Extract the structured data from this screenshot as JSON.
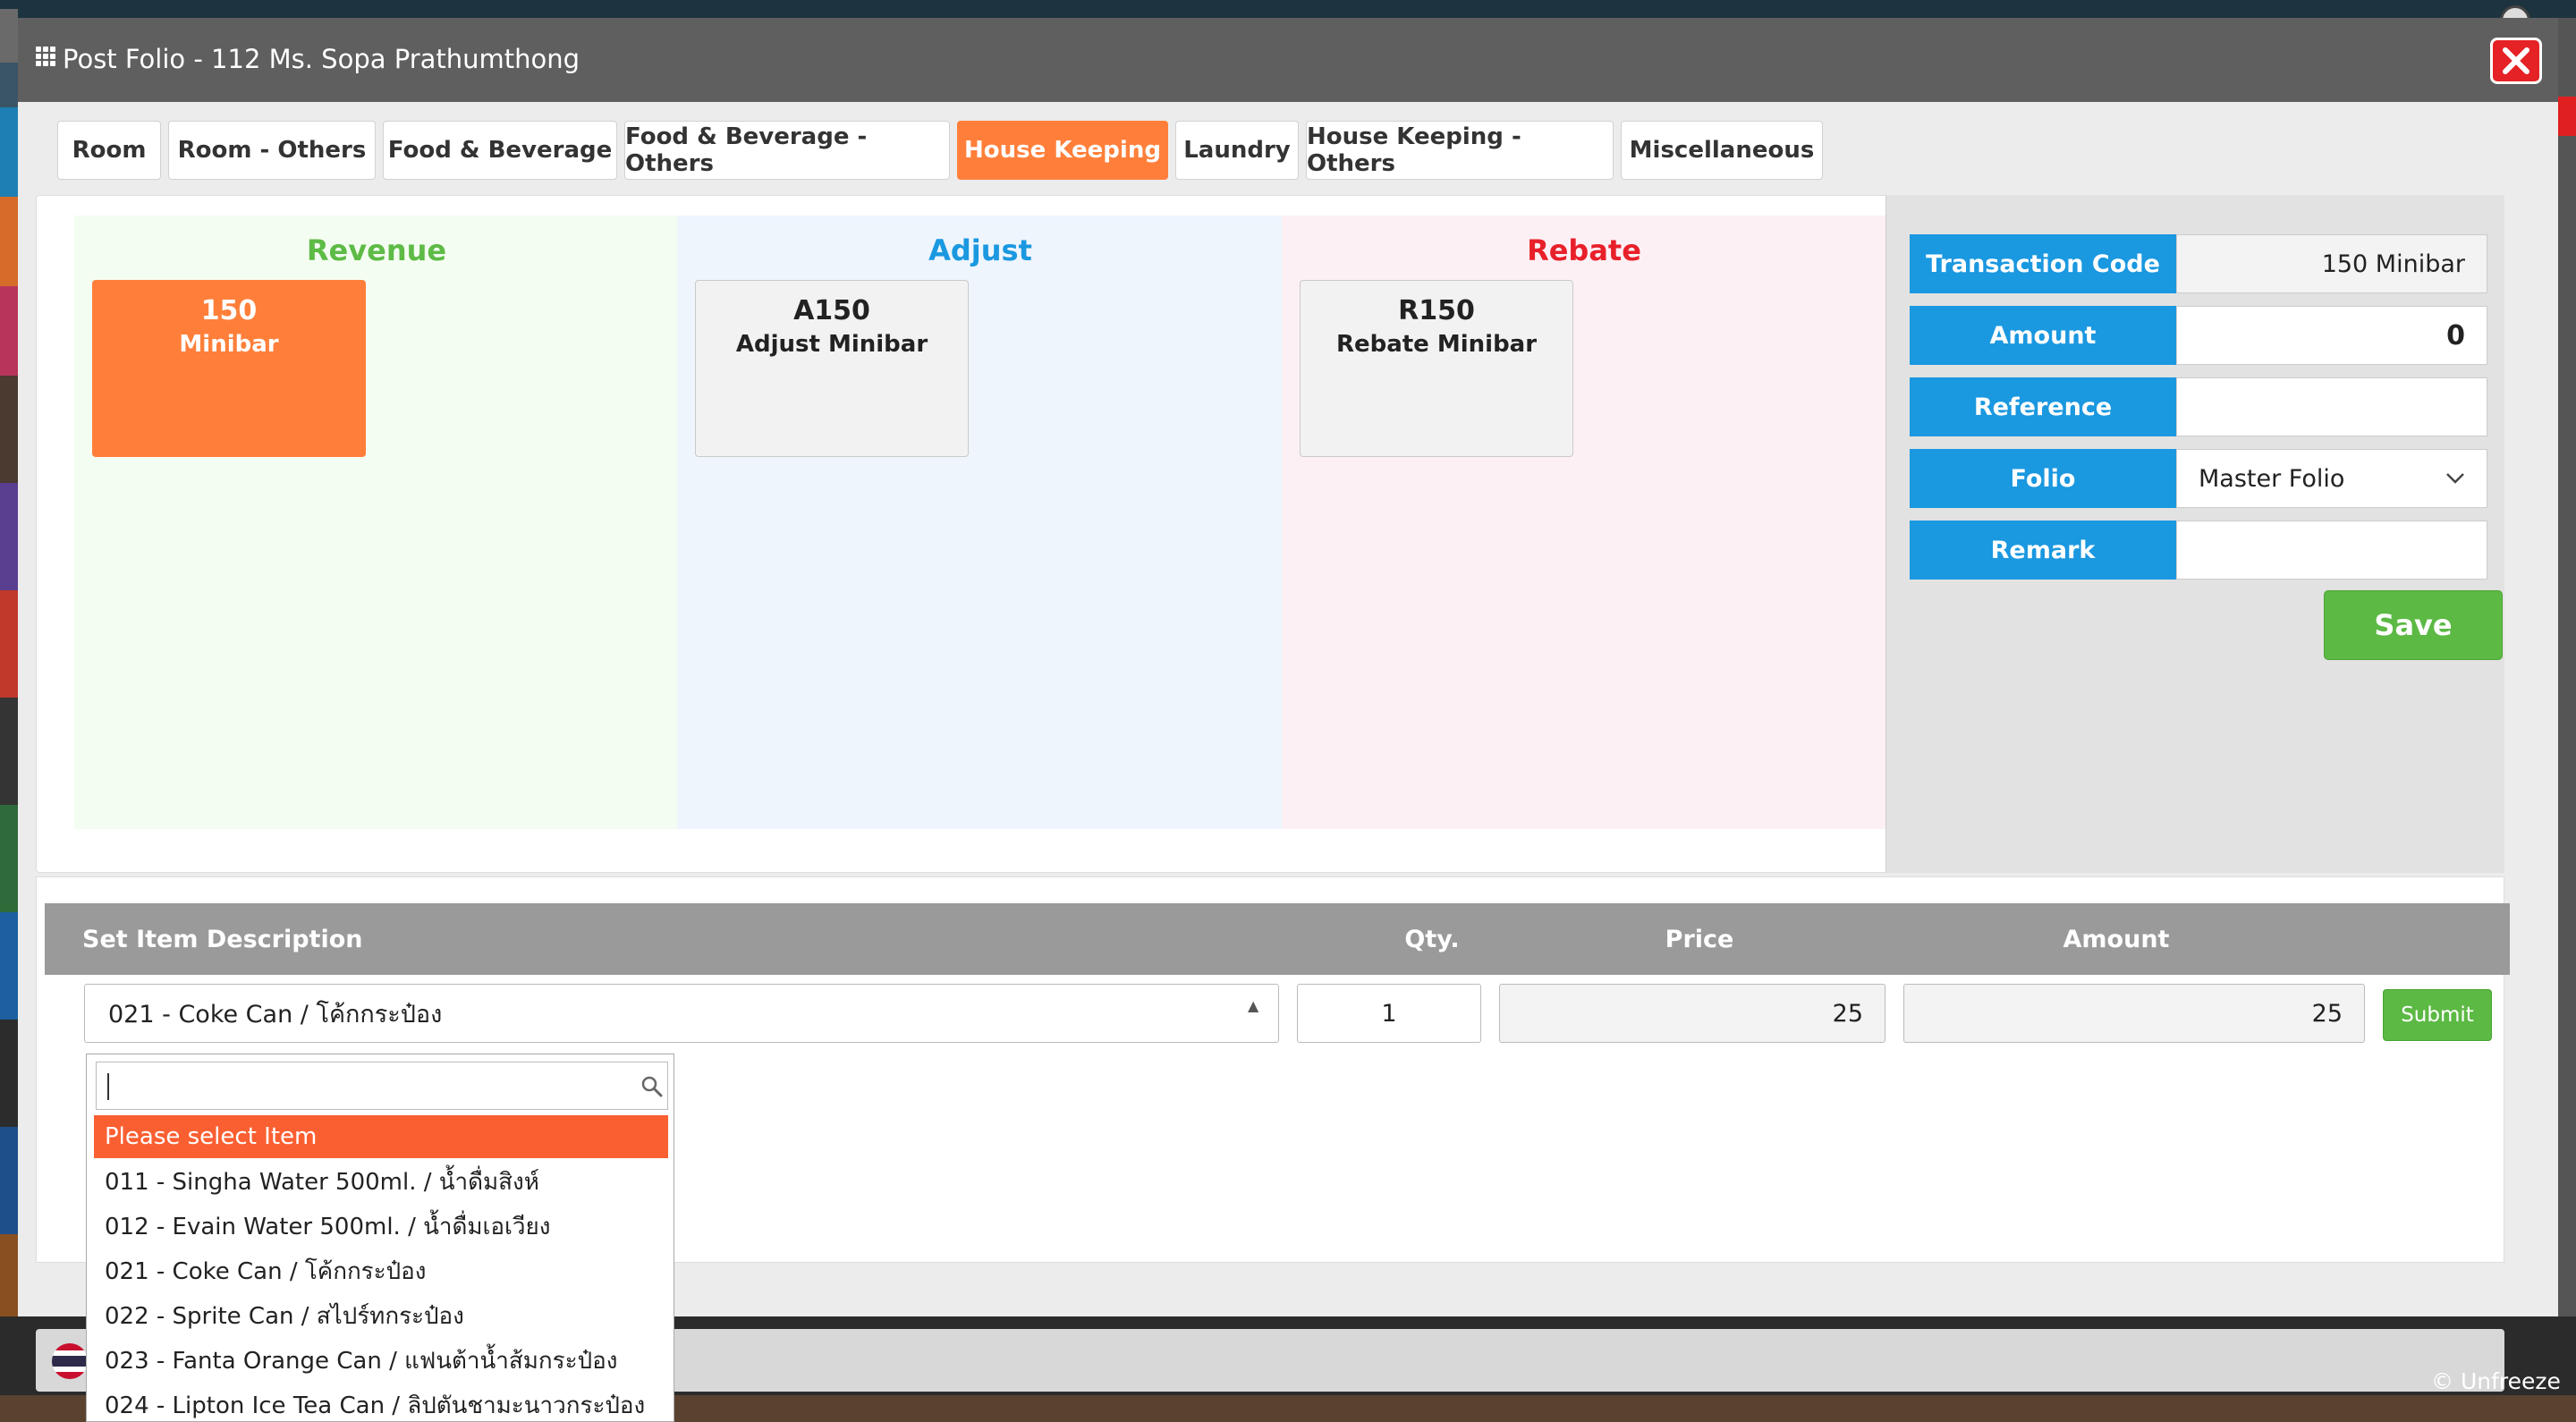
{
  "window": {
    "title": "Post Folio - 112 Ms. Sopa Prathumthong"
  },
  "tabs": [
    {
      "label": "Room"
    },
    {
      "label": "Room - Others"
    },
    {
      "label": "Food & Beverage"
    },
    {
      "label": "Food & Beverage - Others"
    },
    {
      "label": "House Keeping",
      "active": true
    },
    {
      "label": "Laundry"
    },
    {
      "label": "House Keeping - Others"
    },
    {
      "label": "Miscellaneous"
    }
  ],
  "columns": {
    "revenue": {
      "title": "Revenue",
      "color": "#5dbb46",
      "card": {
        "code": "150",
        "name": "Minibar"
      }
    },
    "adjust": {
      "title": "Adjust",
      "color": "#1a98e0",
      "card": {
        "code": "A150",
        "name": "Adjust Minibar"
      }
    },
    "rebate": {
      "title": "Rebate",
      "color": "#e8202a",
      "card": {
        "code": "R150",
        "name": "Rebate Minibar"
      }
    }
  },
  "form": {
    "transaction_code": {
      "label": "Transaction Code",
      "value": "150 Minibar"
    },
    "amount": {
      "label": "Amount",
      "value": "0"
    },
    "reference": {
      "label": "Reference",
      "value": ""
    },
    "folio": {
      "label": "Folio",
      "value": "Master Folio"
    },
    "remark": {
      "label": "Remark",
      "value": ""
    },
    "save_label": "Save"
  },
  "table": {
    "headers": {
      "description": "Set Item Description",
      "qty": "Qty.",
      "price": "Price",
      "amount": "Amount"
    },
    "row": {
      "item": "021 - Coke Can / โค้กกระป๋อง",
      "qty": "1",
      "price": "25",
      "amount": "25",
      "submit_label": "Submit"
    }
  },
  "dropdown": {
    "search_value": "",
    "options": [
      {
        "label": "Please select Item",
        "highlighted": true
      },
      {
        "label": "011 - Singha Water 500ml. / น้ำดื่มสิงห์"
      },
      {
        "label": "012 - Evain Water 500ml. / น้ำดื่มเอเวียง"
      },
      {
        "label": "021 - Coke Can / โค้กกระป๋อง"
      },
      {
        "label": "022 - Sprite Can / สไปร์ทกระป๋อง"
      },
      {
        "label": "023 - Fanta Orange Can / แฟนต้าน้ำส้มกระป๋อง"
      },
      {
        "label": "024 - Lipton Ice Tea Can / ลิปตันชามะนาวกระป๋อง"
      }
    ]
  },
  "footer": {
    "unfreeze_label": "© Unfreeze"
  },
  "colors": {
    "accent": "#ff7f3a",
    "label_blue": "#1a98e0",
    "save_green": "#5cb944",
    "close_red": "#e52225"
  }
}
